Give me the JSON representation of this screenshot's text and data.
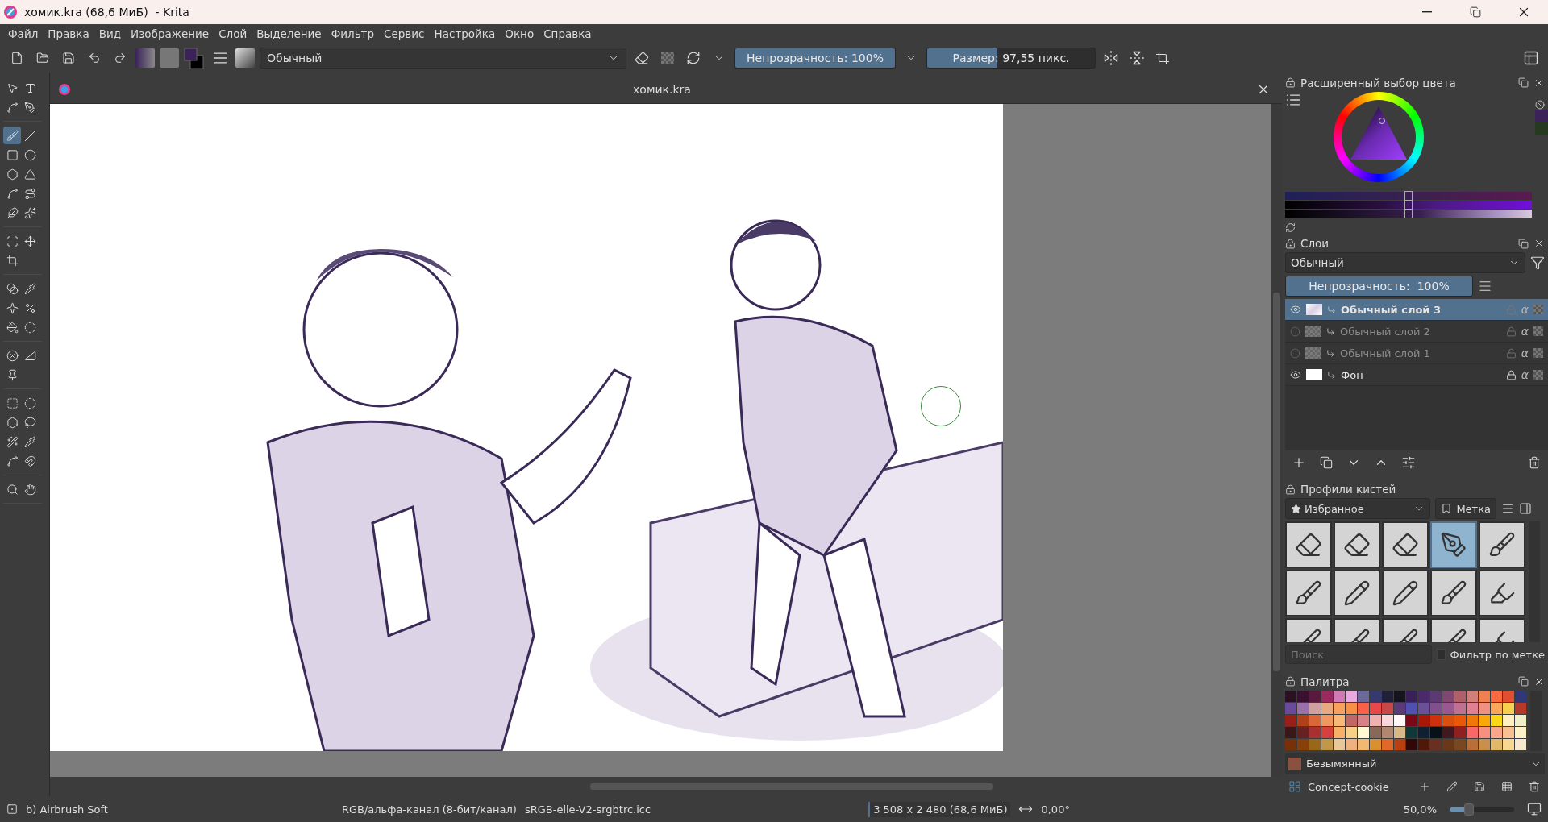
{
  "window": {
    "title": "хомик.kra (68,6 МиБ)  - Krita"
  },
  "menu": [
    "Файл",
    "Правка",
    "Вид",
    "Изображение",
    "Слой",
    "Выделение",
    "Фильтр",
    "Сервис",
    "Настройка",
    "Окно",
    "Справка"
  ],
  "toolbar": {
    "blend_mode": "Обычный",
    "opacity": {
      "label": "Непрозрачность: 100%",
      "level": 1
    },
    "size": {
      "label": "Размер: 97,55 пикс.",
      "level": 0.42
    }
  },
  "toolbox": {
    "groups": [
      [
        {
          "kind": "select",
          "selected": false
        },
        {
          "kind": "text",
          "selected": false
        },
        {
          "kind": "edit-shapes",
          "selected": false
        },
        {
          "kind": "calligraphy",
          "selected": false
        }
      ],
      [
        {
          "kind": "brush",
          "selected": true
        },
        {
          "kind": "line",
          "selected": false
        },
        {
          "kind": "rectangle",
          "selected": false
        },
        {
          "kind": "ellipse",
          "selected": false
        },
        {
          "kind": "polygon",
          "selected": false
        },
        {
          "kind": "polyline",
          "selected": false
        },
        {
          "kind": "bezier",
          "selected": false
        },
        {
          "kind": "path",
          "selected": false
        },
        {
          "kind": "dynamic",
          "selected": false
        },
        {
          "kind": "multibrush",
          "selected": false
        }
      ],
      [
        {
          "kind": "transform",
          "selected": false
        },
        {
          "kind": "move",
          "selected": false
        },
        {
          "kind": "crop",
          "selected": false
        }
      ],
      [
        {
          "kind": "gradient",
          "selected": false
        },
        {
          "kind": "picker",
          "selected": false
        },
        {
          "kind": "smart-patch",
          "selected": false
        },
        {
          "kind": "percent",
          "selected": false
        },
        {
          "kind": "fill",
          "selected": false
        },
        {
          "kind": "enclose",
          "selected": false
        }
      ],
      [
        {
          "kind": "assistant",
          "selected": false
        },
        {
          "kind": "measure",
          "selected": false
        },
        {
          "kind": "reference",
          "selected": false
        }
      ],
      [
        {
          "kind": "rect-select",
          "selected": false
        },
        {
          "kind": "ellipse-select",
          "selected": false
        },
        {
          "kind": "polygon-select",
          "selected": false
        },
        {
          "kind": "lasso",
          "selected": false
        },
        {
          "kind": "wand",
          "selected": false
        },
        {
          "kind": "similar-select",
          "selected": false
        },
        {
          "kind": "bezier-select",
          "selected": false
        },
        {
          "kind": "magnetic",
          "selected": false
        }
      ],
      [
        {
          "kind": "zoom",
          "selected": false
        },
        {
          "kind": "pan",
          "selected": false
        }
      ]
    ]
  },
  "document": {
    "tab": "хомик.kra"
  },
  "color_selector": {
    "title": "Расширенный выбор цвета",
    "sliders": [
      {
        "level": 0.5
      },
      {
        "level": 0.5
      },
      {
        "level": 0.5
      }
    ],
    "recent_colors": [
      {
        "color": "#3b2258"
      },
      {
        "color": "#263a22"
      }
    ]
  },
  "layers": {
    "title": "Слои",
    "blend_mode": "Обычный",
    "opacity": {
      "label": "Непрозрачность:  100%",
      "level": 1
    },
    "items": [
      {
        "name": "Обычный слой 3",
        "visible": true,
        "selected": true,
        "locked": false,
        "kind": "sketch",
        "alpha": "α"
      },
      {
        "name": "Обычный слой 2",
        "visible": false,
        "selected": false,
        "locked": false,
        "kind": "transparent",
        "alpha": "α"
      },
      {
        "name": "Обычный слой 1",
        "visible": false,
        "selected": false,
        "locked": false,
        "kind": "transparent",
        "alpha": "α"
      },
      {
        "name": "Фон",
        "visible": true,
        "selected": false,
        "locked": true,
        "kind": "white",
        "alpha": "α"
      }
    ]
  },
  "brush_presets": {
    "title": "Профили кистей",
    "tag": "Избранное",
    "tag_button": "Метка",
    "search": {
      "placeholder": "Поиск"
    },
    "filter": {
      "label": "Фильтр по метке",
      "checked": false
    },
    "items": [
      {
        "kind": "eraser",
        "selected": false
      },
      {
        "kind": "eraser",
        "selected": false
      },
      {
        "kind": "eraser",
        "selected": false
      },
      {
        "kind": "airbrush",
        "selected": true
      },
      {
        "kind": "brush",
        "selected": false
      },
      {
        "kind": "brush",
        "selected": false
      },
      {
        "kind": "pencil",
        "selected": false
      },
      {
        "kind": "pencil",
        "selected": false
      },
      {
        "kind": "brush",
        "selected": false
      },
      {
        "kind": "marker",
        "selected": false
      },
      {
        "kind": "brush",
        "selected": false
      },
      {
        "kind": "brush",
        "selected": false
      },
      {
        "kind": "brush",
        "selected": false
      },
      {
        "kind": "brush",
        "selected": false
      },
      {
        "kind": "marker",
        "selected": false
      }
    ]
  },
  "palette": {
    "title": "Палитра",
    "swatch": {
      "name": "Безымянный",
      "color": "#8a5040"
    },
    "palette_name": "Concept-cookie",
    "colors": [
      {
        "color": "#2a1020"
      },
      {
        "color": "#3a1030"
      },
      {
        "color": "#5a1a40"
      },
      {
        "color": "#9a2a60"
      },
      {
        "color": "#d07ab8"
      },
      {
        "color": "#e8a8e0"
      },
      {
        "color": "#6a6a9a"
      },
      {
        "color": "#343a70"
      },
      {
        "color": "#20203a"
      },
      {
        "color": "#151520"
      },
      {
        "color": "#3a2058"
      },
      {
        "color": "#4a2a6a"
      },
      {
        "color": "#5a3a70"
      },
      {
        "color": "#804870"
      },
      {
        "color": "#b06068"
      },
      {
        "color": "#d08078"
      },
      {
        "color": "#f08050"
      },
      {
        "color": "#f86a40"
      },
      {
        "color": "#e05030"
      },
      {
        "color": "#303878"
      },
      {
        "color": "#6a4a9a"
      },
      {
        "color": "#9a70a8"
      },
      {
        "color": "#d0a0a0"
      },
      {
        "color": "#e8a880"
      },
      {
        "color": "#f8a060"
      },
      {
        "color": "#f89048"
      },
      {
        "color": "#f86048"
      },
      {
        "color": "#e84848"
      },
      {
        "color": "#c84848"
      },
      {
        "color": "#5a3a78"
      },
      {
        "color": "#5050b0"
      },
      {
        "color": "#6a5098"
      },
      {
        "color": "#80508a"
      },
      {
        "color": "#9a5890"
      },
      {
        "color": "#c07090"
      },
      {
        "color": "#e08090"
      },
      {
        "color": "#f09080"
      },
      {
        "color": "#f8a858"
      },
      {
        "color": "#f8d050"
      },
      {
        "color": "#b83828"
      },
      {
        "color": "#982018"
      },
      {
        "color": "#b04018"
      },
      {
        "color": "#d86838"
      },
      {
        "color": "#f09860"
      },
      {
        "color": "#f8b878"
      },
      {
        "color": "#c06868"
      },
      {
        "color": "#d88088"
      },
      {
        "color": "#f0b0b0"
      },
      {
        "color": "#f8d8d8"
      },
      {
        "color": "#fff8f8"
      },
      {
        "color": "#780818"
      },
      {
        "color": "#a81808"
      },
      {
        "color": "#d03010"
      },
      {
        "color": "#d85010"
      },
      {
        "color": "#e85808"
      },
      {
        "color": "#f07808"
      },
      {
        "color": "#f8a808"
      },
      {
        "color": "#f8d818"
      },
      {
        "color": "#fff0c0"
      },
      {
        "color": "#f0f0c8"
      },
      {
        "color": "#3a1818"
      },
      {
        "color": "#682020"
      },
      {
        "color": "#a83030"
      },
      {
        "color": "#d84040"
      },
      {
        "color": "#f8b068"
      },
      {
        "color": "#f8d088"
      },
      {
        "color": "#fff8d0"
      },
      {
        "color": "#886858"
      },
      {
        "color": "#b08870"
      },
      {
        "color": "#d8b888"
      },
      {
        "color": "#103838"
      },
      {
        "color": "#102030"
      },
      {
        "color": "#081018"
      },
      {
        "color": "#401820"
      },
      {
        "color": "#902020"
      },
      {
        "color": "#f86868"
      },
      {
        "color": "#f89080"
      },
      {
        "color": "#f8a888"
      },
      {
        "color": "#f8c090"
      },
      {
        "color": "#fff2c8"
      },
      {
        "color": "#783008"
      },
      {
        "color": "#884008"
      },
      {
        "color": "#986818"
      },
      {
        "color": "#c09848"
      },
      {
        "color": "#e8c898"
      },
      {
        "color": "#f0b080"
      },
      {
        "color": "#f0b870"
      },
      {
        "color": "#d89030"
      },
      {
        "color": "#e06828"
      },
      {
        "color": "#b84010"
      },
      {
        "color": "#300808"
      },
      {
        "color": "#501808"
      },
      {
        "color": "#683020"
      },
      {
        "color": "#683818"
      },
      {
        "color": "#784820"
      },
      {
        "color": "#b87038"
      },
      {
        "color": "#c89048"
      },
      {
        "color": "#e0b868"
      },
      {
        "color": "#f8d890"
      },
      {
        "color": "#f8e8d0"
      }
    ]
  },
  "status_bar": {
    "preset": "b) Airbrush Soft",
    "color_space": "RGB/альфа-канал (8-бит/канал)",
    "profile": "sRGB-elle-V2-srgbtrc.icc",
    "dimensions": "3 508 x 2 480 (68,6 МиБ)",
    "rotation": "0,00°",
    "zoom": "50,0%",
    "zoom_level": {
      "level": 0.3
    }
  }
}
